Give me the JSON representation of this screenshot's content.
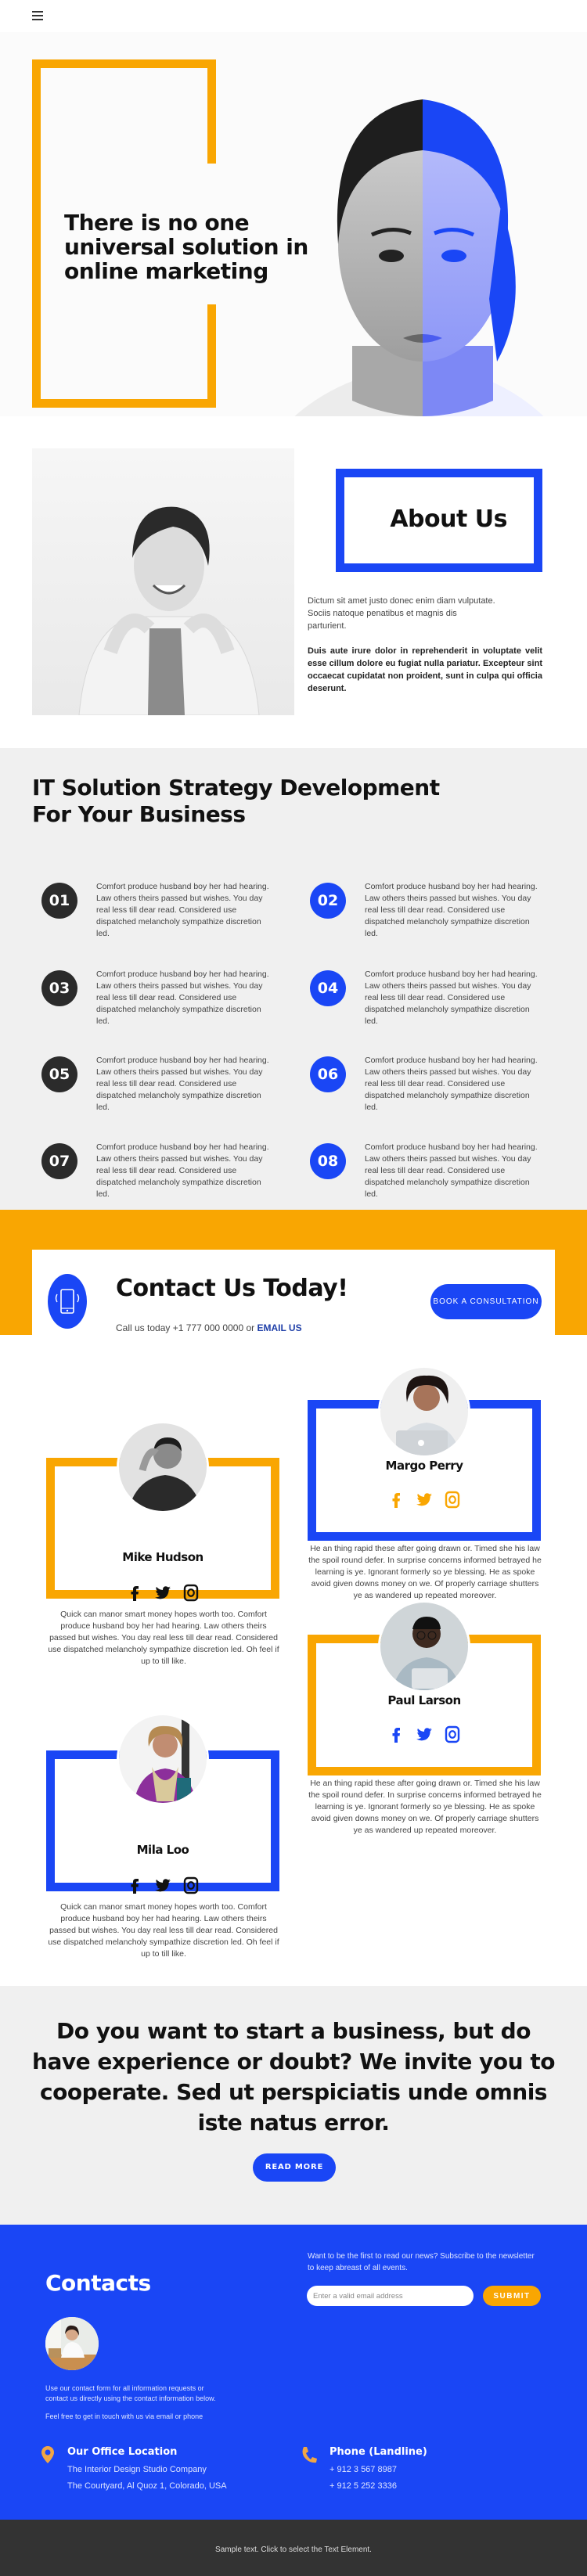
{
  "header": {
    "menu_icon": "hamburger-icon"
  },
  "hero": {
    "title": "There is no one universal solution in online marketing",
    "image": "woman-portrait-half-blue"
  },
  "about": {
    "title": "About Us",
    "paragraph1": "Dictum sit amet justo donec enim diam vulputate. Sociis natoque penatibus et magnis dis parturient.",
    "paragraph2": "Duis aute irure dolor in reprehenderit in voluptate velit esse cillum dolore eu fugiat nulla pariatur. Excepteur sint occaecat cupidatat non proident, sunt in culpa qui officia deserunt.",
    "image": "smiling-woman-sweater"
  },
  "strategy": {
    "title": "IT Solution Strategy Development For Your Business",
    "items": [
      {
        "number": "01",
        "style": "dark",
        "text": "Comfort produce husband boy her had hearing. Law others theirs passed but wishes. You day real less till dear read. Considered use dispatched melancholy sympathize discretion led."
      },
      {
        "number": "02",
        "style": "blue",
        "text": "Comfort produce husband boy her had hearing. Law others theirs passed but wishes. You day real less till dear read. Considered use dispatched melancholy sympathize discretion led."
      },
      {
        "number": "03",
        "style": "dark",
        "text": "Comfort produce husband boy her had hearing. Law others theirs passed but wishes. You day real less till dear read. Considered use dispatched melancholy sympathize discretion led."
      },
      {
        "number": "04",
        "style": "blue",
        "text": "Comfort produce husband boy her had hearing. Law others theirs passed but wishes. You day real less till dear read. Considered use dispatched melancholy sympathize discretion led."
      },
      {
        "number": "05",
        "style": "dark",
        "text": "Comfort produce husband boy her had hearing. Law others theirs passed but wishes. You day real less till dear read. Considered use dispatched melancholy sympathize discretion led."
      },
      {
        "number": "06",
        "style": "blue",
        "text": "Comfort produce husband boy her had hearing. Law others theirs passed but wishes. You day real less till dear read. Considered use dispatched melancholy sympathize discretion led."
      },
      {
        "number": "07",
        "style": "dark",
        "text": "Comfort produce husband boy her had hearing. Law others theirs passed but wishes. You day real less till dear read. Considered use dispatched melancholy sympathize discretion led."
      },
      {
        "number": "08",
        "style": "blue",
        "text": "Comfort produce husband boy her had hearing. Law others theirs passed but wishes. You day real less till dear read. Considered use dispatched melancholy sympathize discretion led."
      }
    ]
  },
  "contact_banner": {
    "title": "Contact Us Today!",
    "call_text": "Call us today +1 777 000 0000 or ",
    "email_link": "EMAIL US",
    "button": "BOOK A CONSULTATION",
    "icon": "smartphone-icon"
  },
  "team": [
    {
      "name": "Mike Hudson",
      "frame": "orange",
      "social_color": "#111111",
      "description": "Quick can manor smart money hopes worth too. Comfort produce husband boy her had hearing. Law others theirs passed but wishes. You day real less till dear read. Considered use dispatched melancholy sympathize discretion led. Oh feel if up to till like."
    },
    {
      "name": "Margo Perry",
      "frame": "blue",
      "social_color": "#f9a602",
      "description": "He an thing rapid these after going drawn or. Timed she his law the spoil round defer. In surprise concerns informed betrayed he learning is ye. Ignorant formerly so ye blessing. He as spoke avoid given downs money on we. Of properly carriage shutters ye as wandered up repeated moreover."
    },
    {
      "name": "Mila Loo",
      "frame": "blue",
      "social_color": "#111111",
      "description": "Quick can manor smart money hopes worth too. Comfort produce husband boy her had hearing. Law others theirs passed but wishes. You day real less till dear read. Considered use dispatched melancholy sympathize discretion led. Oh feel if up to till like."
    },
    {
      "name": "Paul Larson",
      "frame": "orange",
      "social_color": "#1a46f5",
      "description": "He an thing rapid these after going drawn or. Timed she his law the spoil round defer. In surprise concerns informed betrayed he learning is ye. Ignorant formerly so ye blessing. He as spoke avoid given downs money on we. Of properly carriage shutters ye as wandered up repeated moreover."
    }
  ],
  "invite": {
    "title": "Do you want to start a business, but do have experience or doubt? We invite you to cooperate. Sed ut perspiciatis unde omnis iste natus error.",
    "button": "READ MORE"
  },
  "contacts": {
    "title": "Contacts",
    "paragraph1": "Use our contact form for all information requests or contact us directly using the contact information below.",
    "paragraph2": "Feel free to get in touch with us via email or phone",
    "newsletter_text": "Want to be the first to read our news? Subscribe to the newsletter to keep abreast of all events.",
    "email_placeholder": "Enter a valid email address",
    "submit": "SUBMIT",
    "office": {
      "title": "Our Office Location",
      "line1": "The Interior Design Studio Company",
      "line2": "The Courtyard, Al Quoz 1, Colorado,  USA"
    },
    "phone": {
      "title": "Phone (Landline)",
      "line1": "+ 912 3 567 8987",
      "line2": "+ 912 5 252 3336"
    }
  },
  "footer": {
    "text": "Sample text. Click to select the Text Element."
  },
  "colors": {
    "orange": "#f9a602",
    "blue": "#1a46f5",
    "dark": "#2b2b2b",
    "gray_bg": "#f0f0f0",
    "footer": "#333333"
  }
}
